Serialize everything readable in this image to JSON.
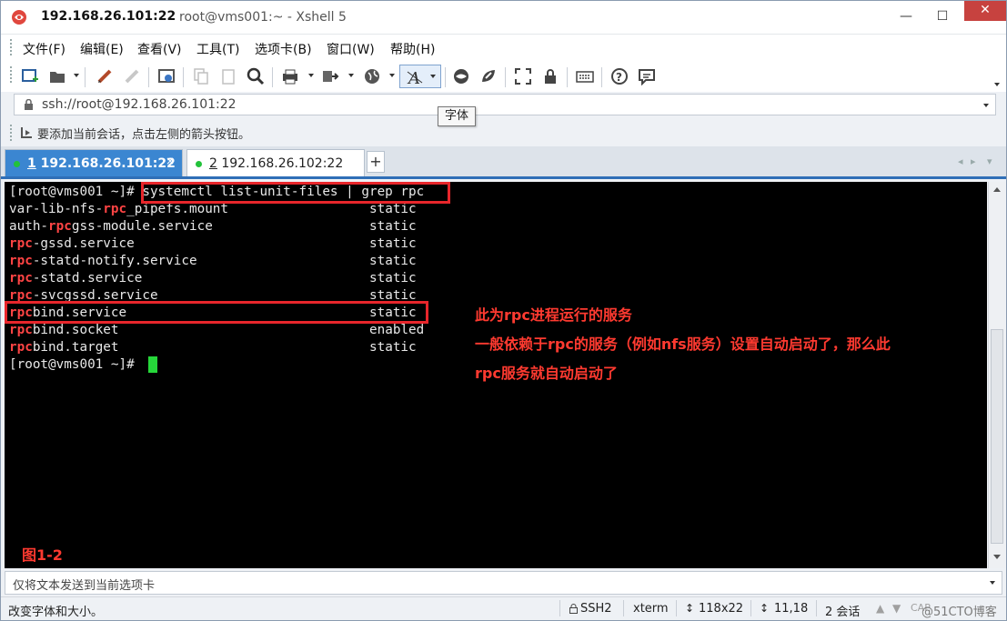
{
  "window": {
    "title_main": "192.168.26.101:22",
    "title_sub": "root@vms001:~ - Xshell 5",
    "minimize": "—",
    "maximize": "☐",
    "close": "✕"
  },
  "menu": [
    {
      "label": "文件(F)"
    },
    {
      "label": "编辑(E)"
    },
    {
      "label": "查看(V)"
    },
    {
      "label": "工具(T)"
    },
    {
      "label": "选项卡(B)"
    },
    {
      "label": "窗口(W)"
    },
    {
      "label": "帮助(H)"
    }
  ],
  "address": {
    "value": "ssh://root@192.168.26.101:22"
  },
  "hint": {
    "text": "要添加当前会话，点击左侧的箭头按钮。"
  },
  "tooltip": {
    "text": "字体"
  },
  "tabs": [
    {
      "label_num": "1",
      "label": " 192.168.26.101:22",
      "close": "×",
      "status_color": "#22c23a"
    },
    {
      "label_num": "2",
      "label": " 192.168.26.102:22",
      "status_color": "#22c23a"
    }
  ],
  "tab_add": "+",
  "terminal": {
    "prompt": "[root@vms001 ~]#",
    "command": " systemctl list-unit-files | grep rpc",
    "rows": [
      {
        "pre": "var-lib-nfs-",
        "hl": "rpc",
        "post": "_pipefs.mount",
        "state": "static"
      },
      {
        "pre": "auth-",
        "hl": "rpc",
        "post": "gss-module.service",
        "state": "static"
      },
      {
        "pre": "",
        "hl": "rpc",
        "post": "-gssd.service",
        "state": "static"
      },
      {
        "pre": "",
        "hl": "rpc",
        "post": "-statd-notify.service",
        "state": "static"
      },
      {
        "pre": "",
        "hl": "rpc",
        "post": "-statd.service",
        "state": "static"
      },
      {
        "pre": "",
        "hl": "rpc",
        "post": "-svcgssd.service",
        "state": "static"
      },
      {
        "pre": "",
        "hl": "rpc",
        "post": "bind.service",
        "state": "static"
      },
      {
        "pre": "",
        "hl": "rpc",
        "post": "bind.socket",
        "state": "enabled"
      },
      {
        "pre": "",
        "hl": "rpc",
        "post": "bind.target",
        "state": "static"
      }
    ],
    "final_prompt": "[root@vms001 ~]#"
  },
  "annotations": {
    "line1": "此为rpc进程运行的服务",
    "line2": "一般依赖于rpc的服务（例如nfs服务）设置自动启动了，那么此",
    "line3": "rpc服务就自动启动了",
    "figure": "图1-2"
  },
  "send_bar": {
    "placeholder": "仅将文本发送到当前选项卡"
  },
  "status": {
    "left": "改变字体和大小。",
    "protocol": "SSH2",
    "term": "xterm",
    "size": "118x22",
    "cursor": "11,18",
    "sessions": "2 会话",
    "caps": "CAP",
    "watermark": "@51CTO博客"
  }
}
